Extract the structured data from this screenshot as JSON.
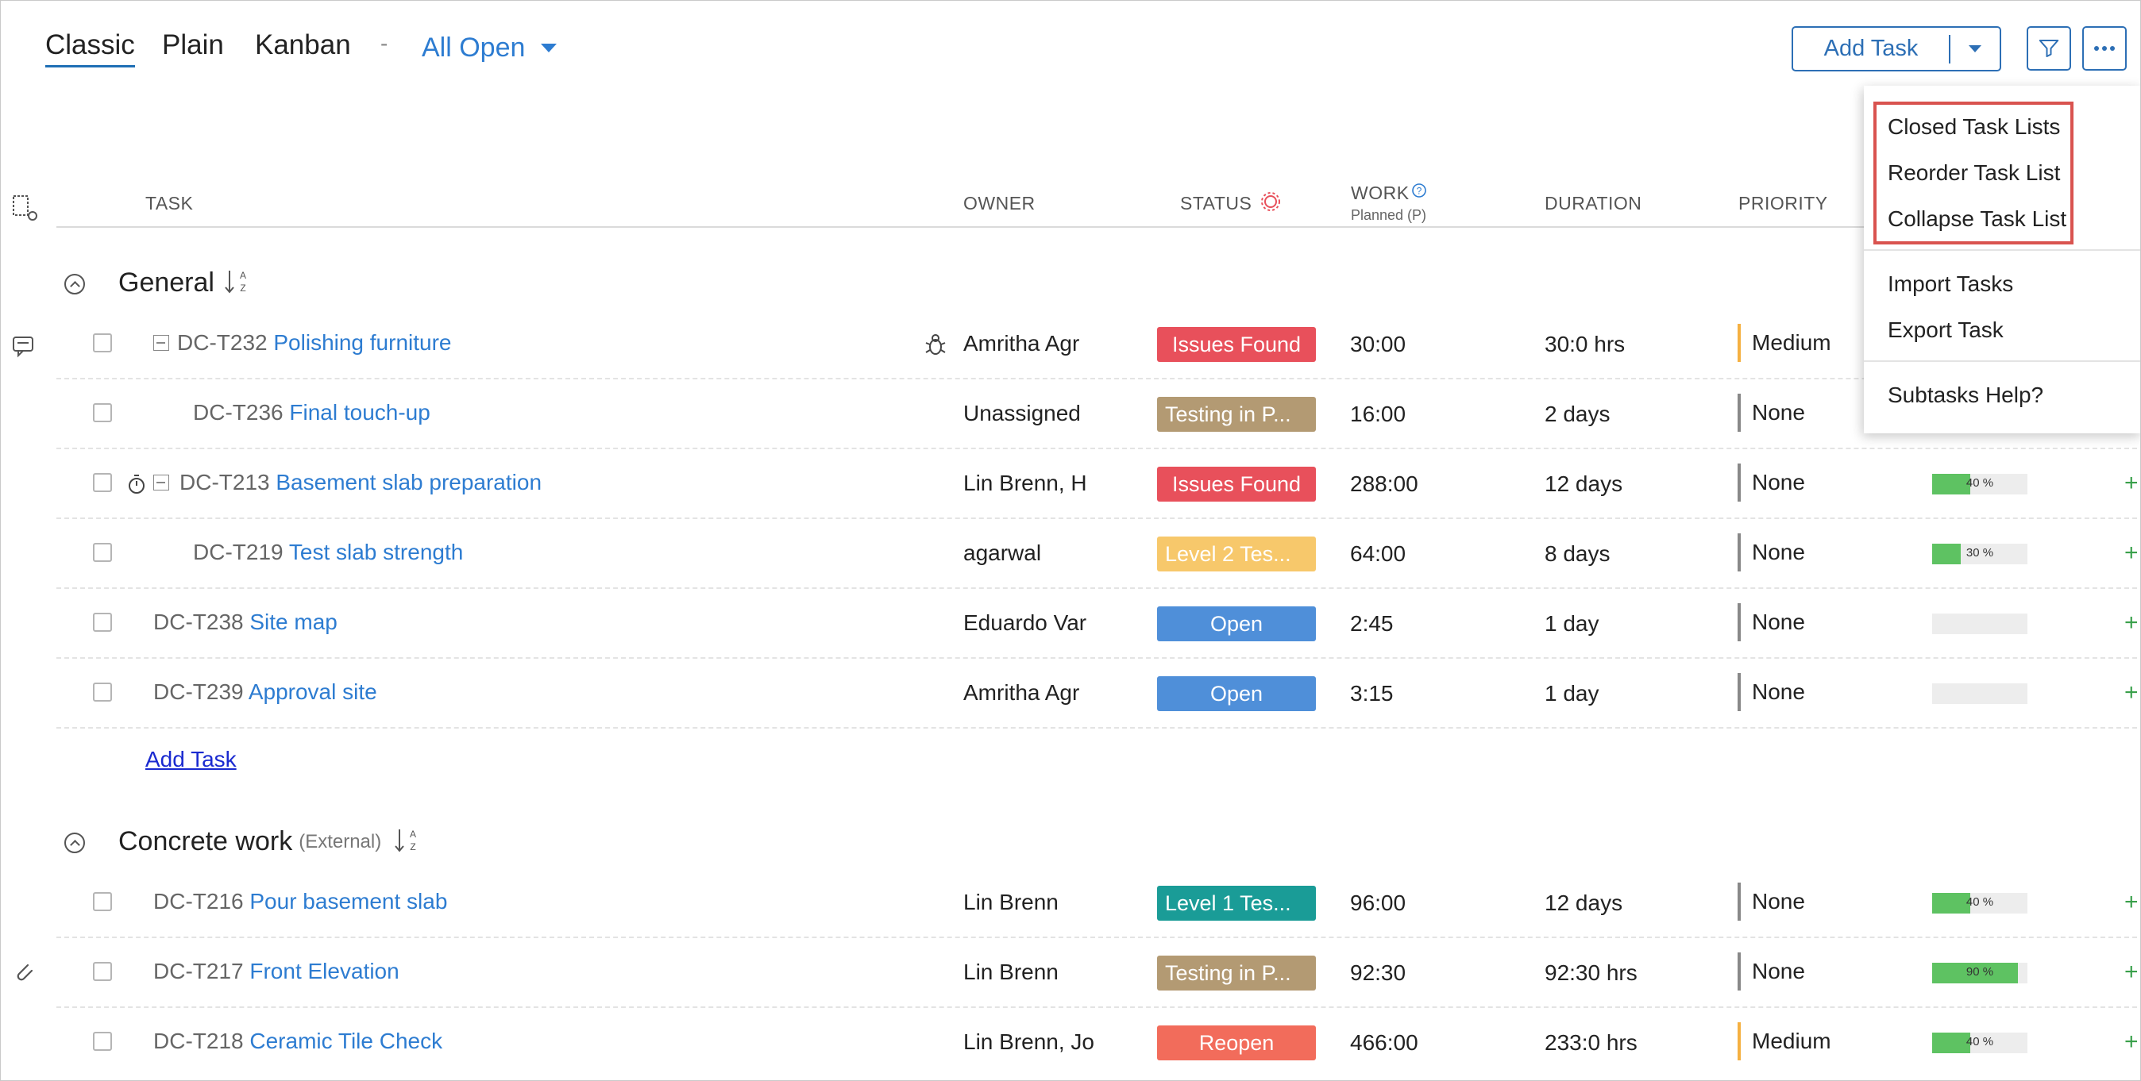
{
  "views": {
    "classic": "Classic",
    "plain": "Plain",
    "kanban": "Kanban",
    "dash": "-",
    "filter": "All Open"
  },
  "toolbar": {
    "add_task": "Add Task"
  },
  "columns": {
    "task": "TASK",
    "owner": "OWNER",
    "status": "STATUS",
    "work": "WORK",
    "work_sub": "Planned (P)",
    "duration": "DURATION",
    "priority": "PRIORITY"
  },
  "groups": [
    {
      "name": "General",
      "external": ""
    },
    {
      "name": "Concrete work",
      "external": "(External)"
    }
  ],
  "tasks": [
    {
      "id": "DC-T232",
      "name": "Polishing furniture",
      "owner": "Amritha Agr",
      "status": "Issues Found",
      "status_color": "#e8505b",
      "work": "30:00",
      "duration": "30:0 hrs",
      "priority": "Medium",
      "priority_color": "#f5b041"
    },
    {
      "id": "DC-T236",
      "name": "Final touch-up",
      "owner": "Unassigned",
      "status": "Testing in P...",
      "status_color": "#b39a73",
      "work": "16:00",
      "duration": "2 days",
      "priority": "None",
      "priority_color": "#888888"
    },
    {
      "id": "DC-T213",
      "name": "Basement slab preparation",
      "owner": "Lin Brenn, H",
      "status": "Issues Found",
      "status_color": "#e8505b",
      "work": "288:00",
      "duration": "12 days",
      "priority": "None",
      "priority_color": "#888888",
      "progress": "40 %",
      "progress_value": 0.4
    },
    {
      "id": "DC-T219",
      "name": "Test slab strength",
      "owner": "agarwal",
      "status": "Level 2 Tes...",
      "status_color": "#f7c86b",
      "work": "64:00",
      "duration": "8 days",
      "priority": "None",
      "priority_color": "#888888",
      "progress": "30 %",
      "progress_value": 0.3
    },
    {
      "id": "DC-T238",
      "name": "Site map",
      "owner": "Eduardo Var",
      "status": "Open",
      "status_color": "#4f8fd9",
      "work": "2:45",
      "duration": "1 day",
      "priority": "None",
      "priority_color": "#888888",
      "progress_value": 0
    },
    {
      "id": "DC-T239",
      "name": "Approval site",
      "owner": "Amritha Agr",
      "status": "Open",
      "status_color": "#4f8fd9",
      "work": "3:15",
      "duration": "1 day",
      "priority": "None",
      "priority_color": "#888888",
      "progress_value": 0
    },
    {
      "id": "DC-T216",
      "name": "Pour basement slab",
      "owner": "Lin Brenn",
      "status": "Level 1 Tes...",
      "status_color": "#1a9c97",
      "work": "96:00",
      "duration": "12 days",
      "priority": "None",
      "priority_color": "#888888",
      "progress": "40 %",
      "progress_value": 0.4
    },
    {
      "id": "DC-T217",
      "name": "Front Elevation",
      "owner": "Lin Brenn",
      "status": "Testing in P...",
      "status_color": "#b39a73",
      "work": "92:30",
      "duration": "92:30 hrs",
      "priority": "None",
      "priority_color": "#888888",
      "progress": "90 %",
      "progress_value": 0.9
    },
    {
      "id": "DC-T218",
      "name": "Ceramic Tile Check",
      "owner": "Lin Brenn, Jo",
      "status": "Reopen",
      "status_color": "#f26c5b",
      "work": "466:00",
      "duration": "233:0 hrs",
      "priority": "Medium",
      "priority_color": "#f5b041",
      "progress": "40 %",
      "progress_value": 0.4
    }
  ],
  "add_task_link": "Add Task",
  "plus": "+",
  "menu": {
    "items": [
      "Closed Task Lists",
      "Reorder Task List",
      "Collapse Task List",
      "Import Tasks",
      "Export Task",
      "Subtasks Help?"
    ]
  }
}
